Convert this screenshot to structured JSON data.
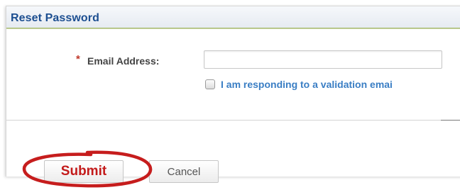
{
  "header": {
    "title": "Reset Password"
  },
  "form": {
    "required_mark": "*",
    "email_label": "Email Address:",
    "email_value": "",
    "validation_checkbox_label": "I am responding to a validation emai",
    "validation_checked": false
  },
  "buttons": {
    "submit_label": "Submit",
    "cancel_label": "Cancel"
  },
  "annotation": {
    "highlight_color": "#c61d1d",
    "highlight_target": "submit"
  },
  "colors": {
    "header_text": "#1d4f91",
    "link_text": "#3a7ec4",
    "submit_text": "#c31a1a",
    "required_star": "#c0392b"
  }
}
